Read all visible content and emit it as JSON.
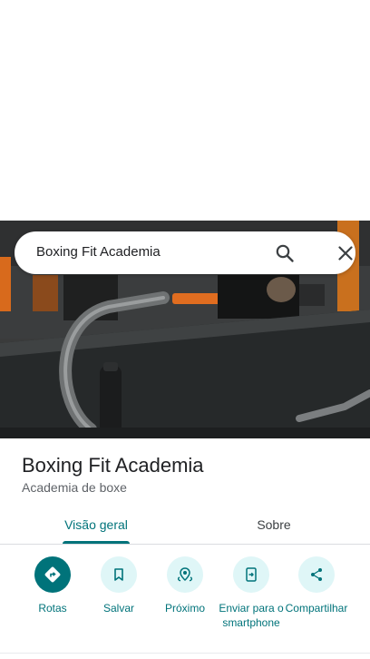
{
  "search": {
    "query": "Boxing Fit Academia"
  },
  "place": {
    "name": "Boxing Fit Academia",
    "category": "Academia de boxe"
  },
  "tabs": [
    {
      "label": "Visão geral",
      "active": true
    },
    {
      "label": "Sobre",
      "active": false
    }
  ],
  "actions": [
    {
      "label": "Rotas",
      "icon": "directions-icon"
    },
    {
      "label": "Salvar",
      "icon": "bookmark-icon"
    },
    {
      "label": "Próximo",
      "icon": "nearby-icon"
    },
    {
      "label": "Enviar para o smartphone",
      "icon": "send-to-phone-icon"
    },
    {
      "label": "Compartilhar",
      "icon": "share-icon"
    }
  ],
  "colors": {
    "accent": "#00737a",
    "button_bg": "#dff6f7",
    "text_primary": "#202124",
    "text_secondary": "#5f6368"
  }
}
